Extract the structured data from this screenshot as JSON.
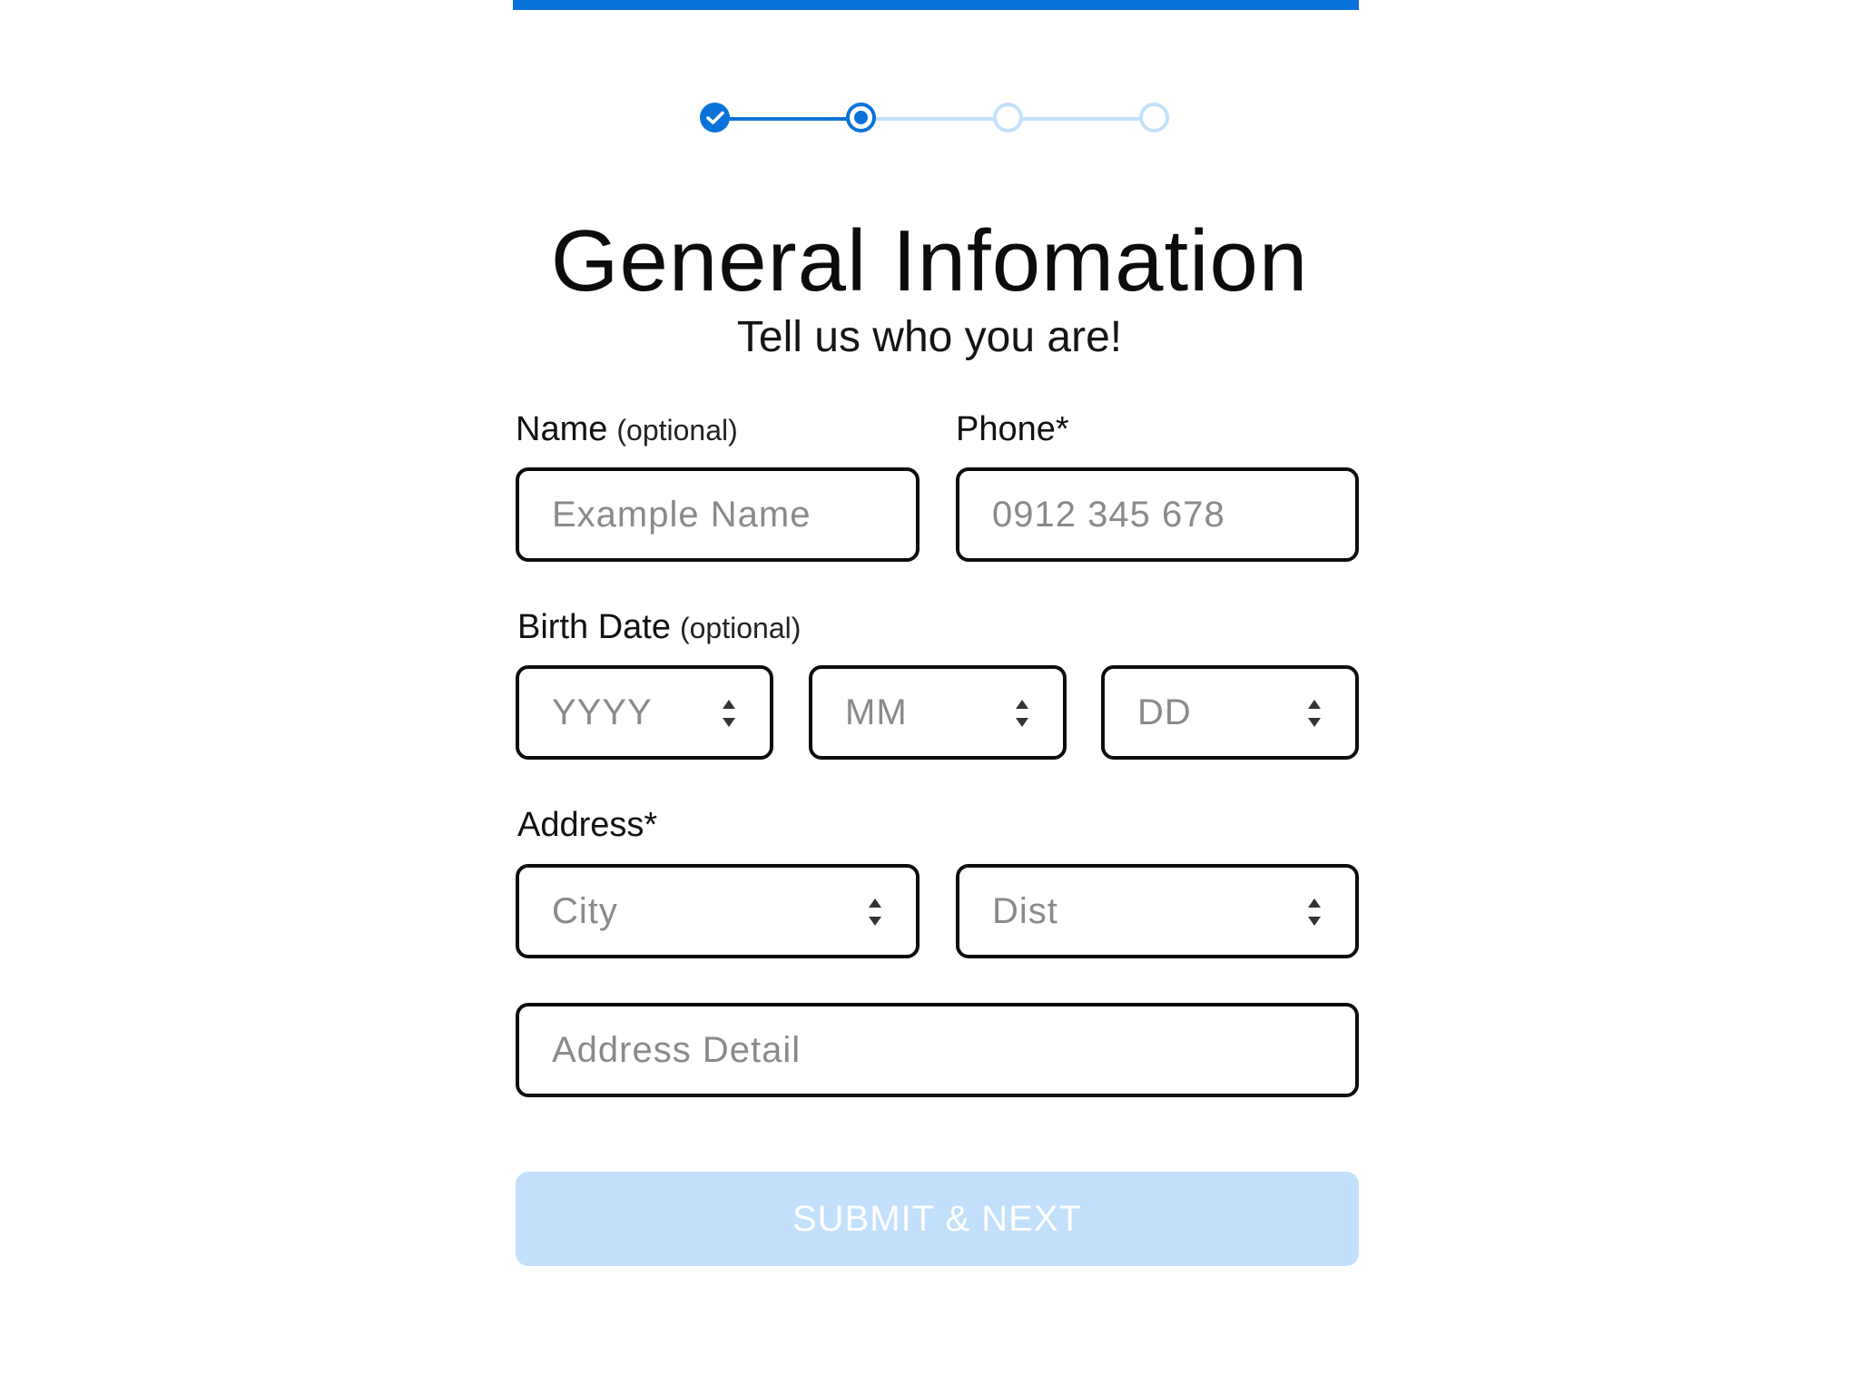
{
  "header": {
    "title": "General Infomation",
    "subtitle": "Tell us who you are!"
  },
  "stepper": {
    "steps": [
      "done",
      "active",
      "todo",
      "todo"
    ],
    "colors": {
      "accent": "#0a73d9",
      "inactive": "#c2e0fb"
    }
  },
  "form": {
    "name": {
      "label": "Name",
      "note": "(optional)",
      "placeholder": "Example Name"
    },
    "phone": {
      "label": "Phone*",
      "placeholder": "0912 345 678"
    },
    "birth_date": {
      "label": "Birth Date",
      "note": "(optional)",
      "year_placeholder": "YYYY",
      "month_placeholder": "MM",
      "day_placeholder": "DD"
    },
    "address": {
      "label": "Address*",
      "city_placeholder": "City",
      "dist_placeholder": "Dist",
      "detail_placeholder": "Address Detail"
    },
    "submit_label": "SUBMIT & NEXT"
  }
}
